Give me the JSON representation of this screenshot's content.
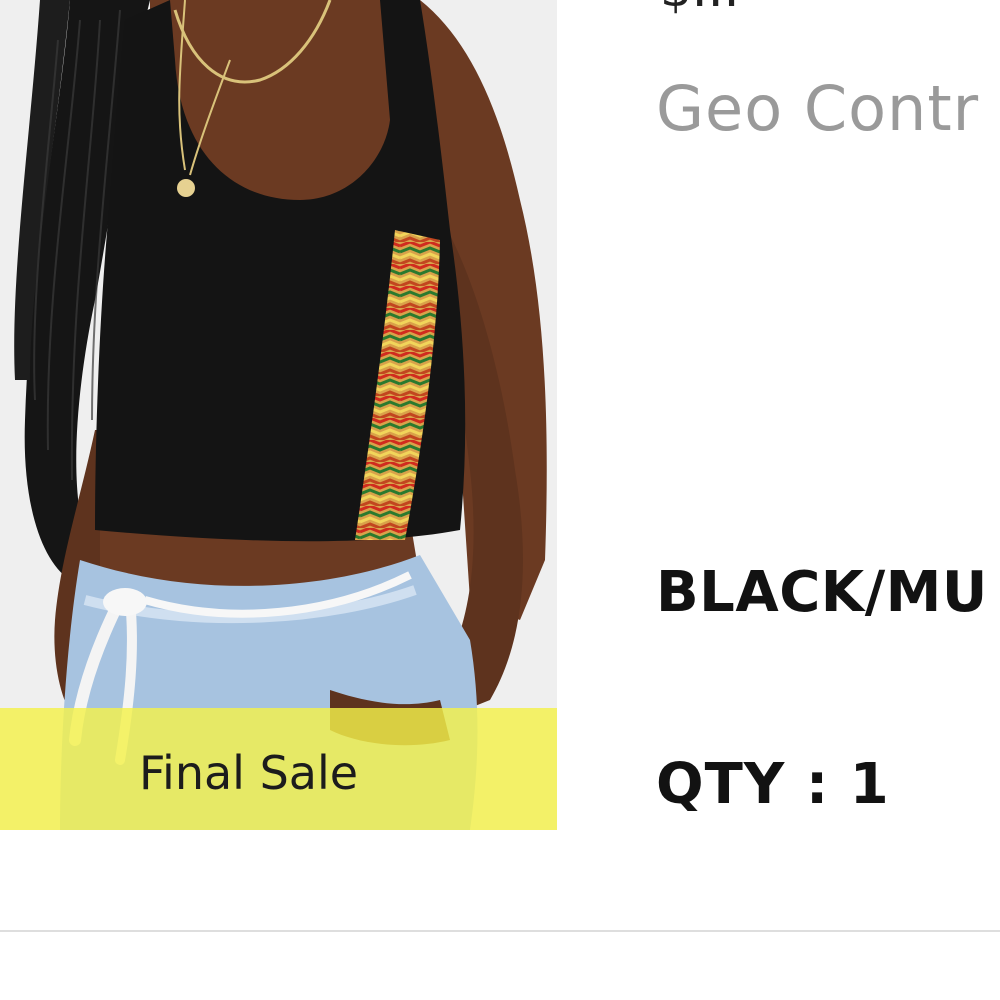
{
  "item": {
    "image_alt": "Black crop tank top with zigzag side stripe",
    "badge": "Final Sale",
    "price_partial": "$...",
    "name": "Geo Contr",
    "color": "BLACK/MU",
    "qty_label": "QTY : 1"
  },
  "colors": {
    "banner": "#f4f24a",
    "name_text": "#9a9a9a",
    "detail_text": "#121212",
    "divider": "#dedede"
  }
}
